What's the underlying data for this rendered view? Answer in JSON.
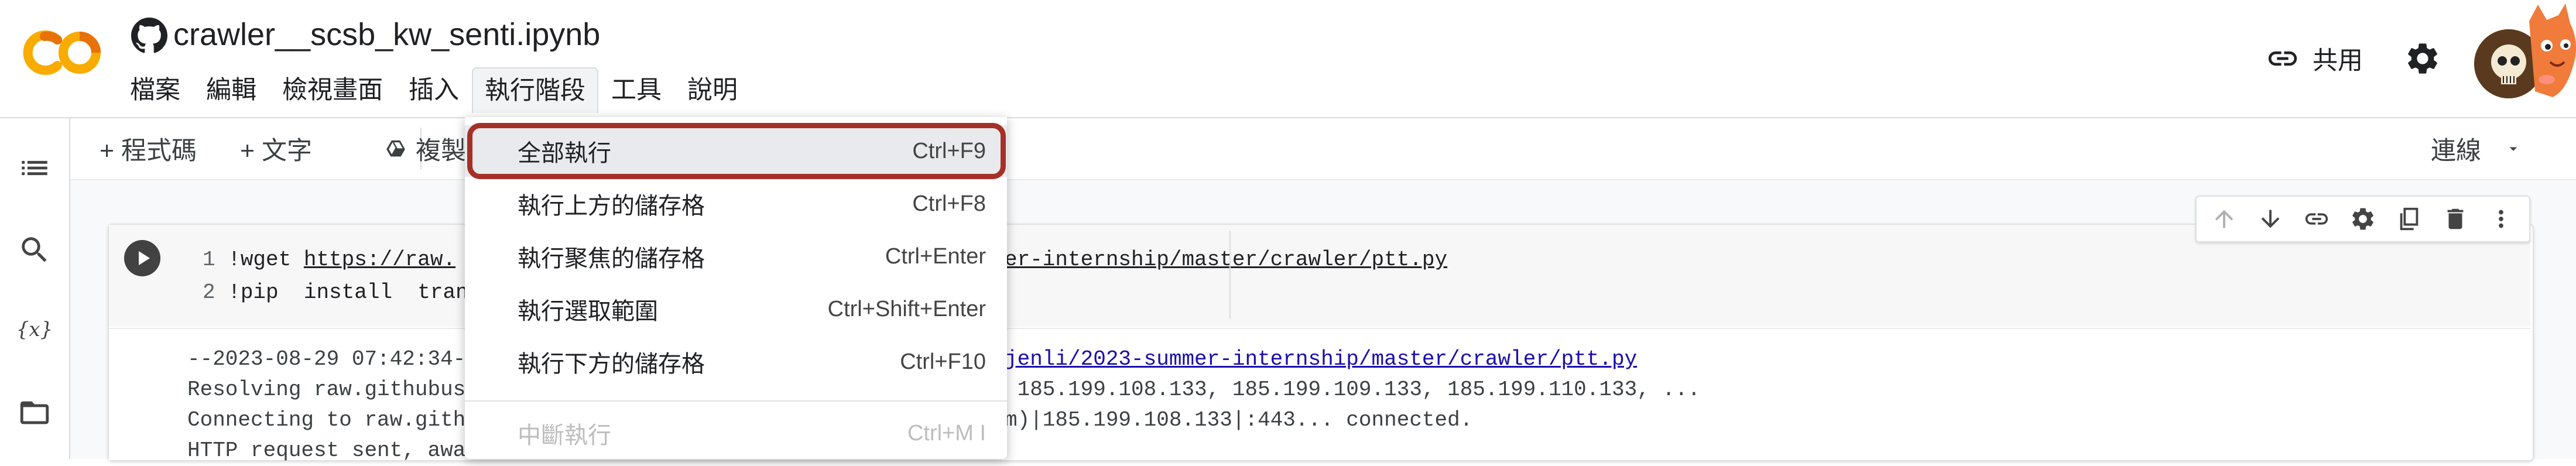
{
  "header": {
    "logo": "colab-logo",
    "notebook_title": "crawler__scsb_kw_senti.ipynb",
    "share_label": "共用"
  },
  "menubar": {
    "items": [
      "檔案",
      "編輯",
      "檢視畫面",
      "插入",
      "執行階段",
      "工具",
      "說明"
    ],
    "active": "執行階段"
  },
  "toolbar": {
    "add_code": "+ 程式碼",
    "add_text": "+ 文字",
    "copy_to_drive": "複製",
    "connect": "連線"
  },
  "dropdown": {
    "items": [
      {
        "label": "全部執行",
        "shortcut": "Ctrl+F9"
      },
      {
        "label": "執行上方的儲存格",
        "shortcut": "Ctrl+F8"
      },
      {
        "label": "執行聚焦的儲存格",
        "shortcut": "Ctrl+Enter"
      },
      {
        "label": "執行選取範圍",
        "shortcut": "Ctrl+Shift+Enter"
      },
      {
        "label": "執行下方的儲存格",
        "shortcut": "Ctrl+F10"
      },
      {
        "label": "中斷執行",
        "shortcut": "Ctrl+M I"
      }
    ]
  },
  "cell": {
    "line1_num": "1",
    "line1_cmd": "!wget ",
    "line1_url_start": "https://raw.",
    "line1_url_end": "er-internship/master/crawler/ptt.py",
    "line2_num": "2",
    "line2_code": "!pip  install  tran"
  },
  "output": {
    "l1_start": "--2023-08-29 07:42:34-",
    "l1_url": "jenli/2023-summer-internship/master/crawler/ptt.py",
    "l2_start": "Resolving raw.githubus",
    "l2_end": " 185.199.108.133, 185.199.109.133, 185.199.110.133, ...",
    "l3_start": "Connecting to raw.gith",
    "l3_end": "m)|185.199.108.133|:443... connected.",
    "l4_start": "HTTP request sent, awa"
  },
  "colors": {
    "highlight": "#a63028",
    "logo_orange": "#f9ab00",
    "logo_dark_orange": "#e8710a"
  }
}
